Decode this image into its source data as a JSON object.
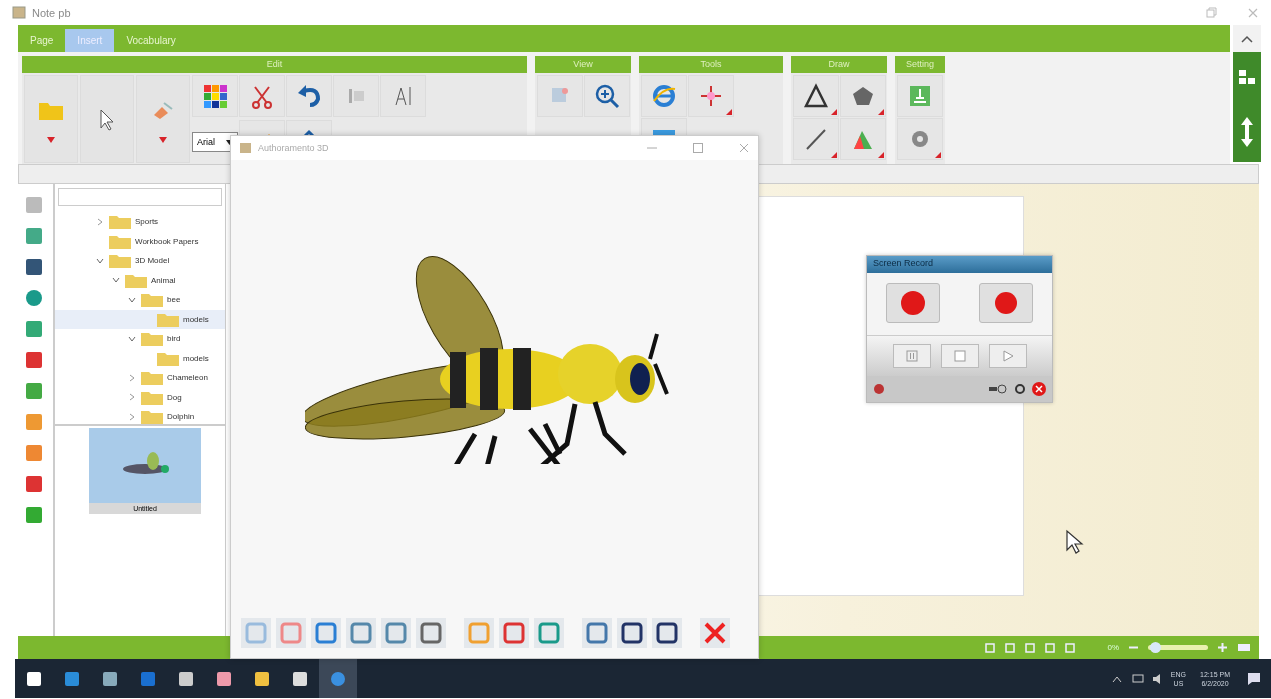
{
  "window": {
    "title": "Note pb"
  },
  "ribbon_tabs": [
    {
      "label": "Page",
      "selected": false
    },
    {
      "label": "Insert",
      "selected": true
    },
    {
      "label": "Vocabulary",
      "selected": false
    }
  ],
  "ribbon_groups": [
    {
      "title": "Edit"
    },
    {
      "title": "View"
    },
    {
      "title": "Tools"
    },
    {
      "title": "Draw"
    },
    {
      "title": "Setting"
    }
  ],
  "font_field": {
    "value": "Arial"
  },
  "tree": [
    {
      "label": "Sports",
      "expanded": false,
      "selected": false
    },
    {
      "label": "Workbook Papers",
      "selected": false
    },
    {
      "label": "3D Model",
      "expanded": true,
      "selected": false,
      "children": [
        {
          "label": "Animal",
          "expanded": true,
          "selected": false,
          "children": [
            {
              "label": "bee",
              "expanded": true,
              "selected": false,
              "children": [
                {
                  "label": "models",
                  "selected": true
                }
              ]
            },
            {
              "label": "bird",
              "expanded": true,
              "selected": false,
              "children": [
                {
                  "label": "models",
                  "selected": false
                }
              ]
            },
            {
              "label": "Chameleon",
              "expanded": false,
              "selected": false
            },
            {
              "label": "Dog",
              "expanded": false,
              "selected": false
            },
            {
              "label": "Dolphin",
              "expanded": false,
              "selected": false
            }
          ]
        }
      ]
    }
  ],
  "thumbnail": {
    "label": "Untitled"
  },
  "model_window": {
    "title": "Authoramento 3D"
  },
  "recorder": {
    "title": "Screen Record"
  },
  "status_bar": {
    "zoom": "0%",
    "level": 0.12
  },
  "taskbar": {
    "language": "ENG",
    "region": "US",
    "time": "12:15 PM",
    "date": "6/2/2020"
  }
}
